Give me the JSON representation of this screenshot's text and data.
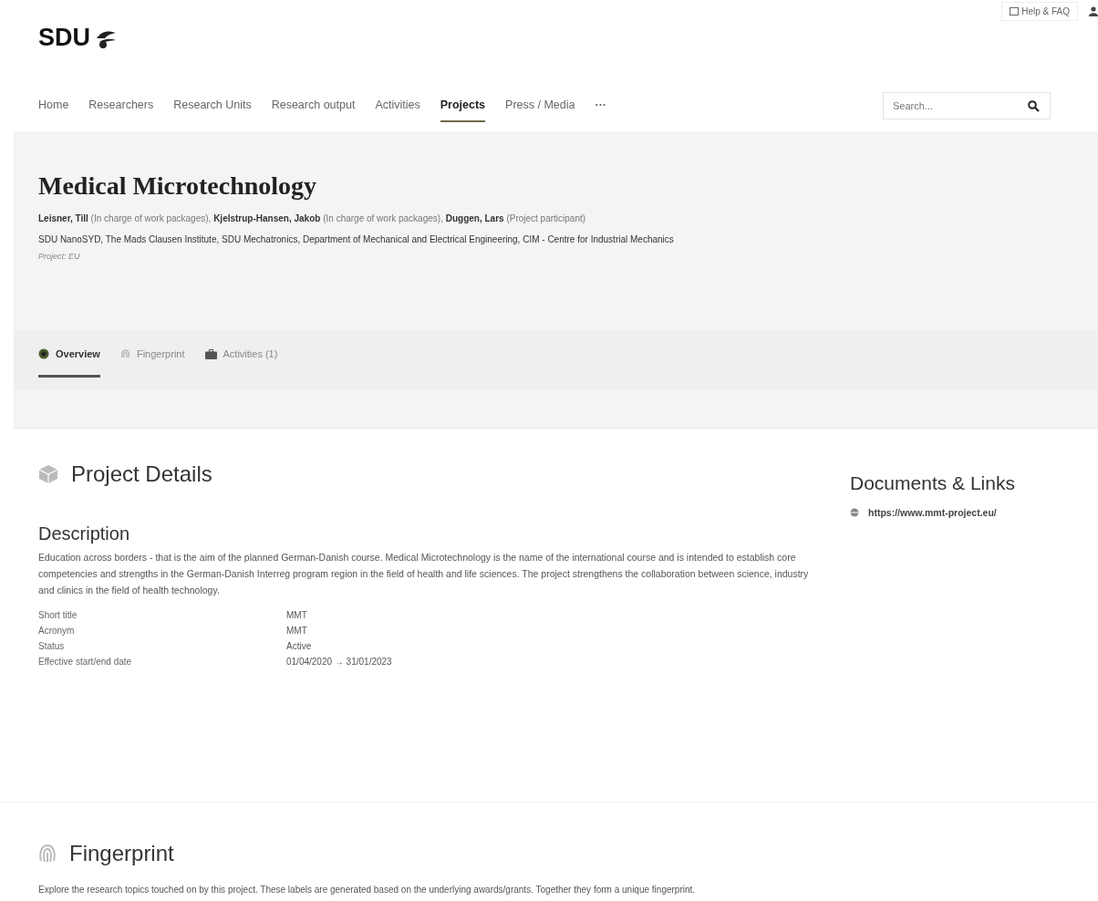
{
  "header": {
    "logo": "SDU",
    "help_link": "Help & FAQ"
  },
  "nav": {
    "items": [
      {
        "label": "Home",
        "selected": false
      },
      {
        "label": "Researchers",
        "selected": false
      },
      {
        "label": "Research Units",
        "selected": false
      },
      {
        "label": "Research output",
        "selected": false
      },
      {
        "label": "Activities",
        "selected": false
      },
      {
        "label": "Projects",
        "selected": true
      },
      {
        "label": "Press / Media",
        "selected": false
      }
    ],
    "more": "···",
    "search": {
      "placeholder": "Search..."
    }
  },
  "project": {
    "title": "Medical Microtechnology",
    "participants": "**Leisner, Till** (In charge of work packages), **Kjelstrup-Hansen, Jakob** (In charge of work packages), **Duggen, Lars** (Project participant)",
    "units": "SDU NanoSYD, The Mads Clausen Institute, SDU Mechatronics, Department of Mechanical and Electrical Engineering, CIM - Centre for Industrial Mechanics",
    "type": "Project: EU"
  },
  "tabs": [
    {
      "label": "Overview",
      "kind": "overview",
      "selected": true
    },
    {
      "label": "Fingerprint",
      "kind": "fingerprint",
      "selected": false
    },
    {
      "label": "Activities (1)",
      "kind": "activities",
      "selected": false
    }
  ],
  "details": {
    "heading": "Project Details",
    "description_heading": "Description",
    "description": "Education across borders - that is the aim of the planned German-Danish course. Medical Microtechnology is the name of the international course and is intended to establish core competencies and strengths in the German-Danish Interreg program region in the field of health and life sciences. The project strengthens the collaboration between science, industry and clinics in the field of health technology.",
    "fields": [
      {
        "label": "Short title",
        "value": "MMT"
      },
      {
        "label": "Acronym",
        "value": "MMT"
      },
      {
        "label": "Status",
        "value": "Active"
      },
      {
        "label": "Effective start/end date",
        "value": "01/04/2020 → 31/01/2023"
      }
    ]
  },
  "documents": {
    "heading": "Documents & Links",
    "links": [
      "https://www.mmt-project.eu/"
    ]
  },
  "fingerprint": {
    "heading": "Fingerprint",
    "text": "Explore the research topics touched on by this project. These labels are generated based on the underlying awards/grants. Together they form a unique fingerprint."
  }
}
